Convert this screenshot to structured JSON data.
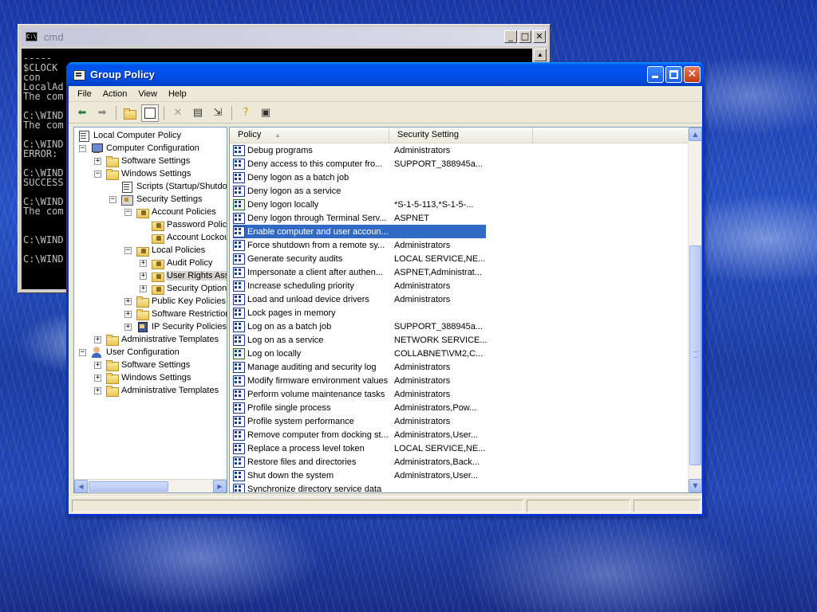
{
  "cmd": {
    "title": "cmd",
    "lines": [
      "-----",
      "$CLOCK",
      "con",
      "LocalAd",
      "The com",
      "",
      "C:\\WIND",
      "The com",
      "",
      "C:\\WIND",
      "ERROR:",
      "",
      "C:\\WIND",
      "SUCCESS",
      "",
      "C:\\WIND",
      "The com",
      "",
      "",
      "C:\\WIND",
      "",
      "C:\\WIND"
    ]
  },
  "window": {
    "title": "Group Policy"
  },
  "menu": {
    "file": "File",
    "action": "Action",
    "view": "View",
    "help": "Help"
  },
  "tree": {
    "root": "Local Computer Policy",
    "computer_config": "Computer Configuration",
    "cc_software": "Software Settings",
    "cc_windows": "Windows Settings",
    "scripts": "Scripts (Startup/Shutdown)",
    "security": "Security Settings",
    "account_policies": "Account Policies",
    "password_policy": "Password Policy",
    "account_lockout": "Account Lockout Policy",
    "local_policies": "Local Policies",
    "audit_policy": "Audit Policy",
    "user_rights": "User Rights Assignment",
    "security_options": "Security Options",
    "public_key": "Public Key Policies",
    "software_restriction": "Software Restriction Policies",
    "ip_security": "IP Security Policies",
    "cc_admin_templates": "Administrative Templates",
    "user_config": "User Configuration",
    "uc_software": "Software Settings",
    "uc_windows": "Windows Settings",
    "uc_admin_templates": "Administrative Templates"
  },
  "list": {
    "col_policy": "Policy",
    "col_setting": "Security Setting",
    "rows": [
      {
        "policy": "Debug programs",
        "setting": "Administrators"
      },
      {
        "policy": "Deny access to this computer fro...",
        "setting": "SUPPORT_388945a..."
      },
      {
        "policy": "Deny logon as a batch job",
        "setting": ""
      },
      {
        "policy": "Deny logon as a service",
        "setting": ""
      },
      {
        "policy": "Deny logon locally",
        "setting": "*S-1-5-113,*S-1-5-..."
      },
      {
        "policy": "Deny logon through Terminal Serv...",
        "setting": "ASPNET"
      },
      {
        "policy": "Enable computer and user accoun...",
        "setting": ""
      },
      {
        "policy": "Force shutdown from a remote sy...",
        "setting": "Administrators"
      },
      {
        "policy": "Generate security audits",
        "setting": "LOCAL SERVICE,NE..."
      },
      {
        "policy": "Impersonate a client after authen...",
        "setting": "ASPNET,Administrat..."
      },
      {
        "policy": "Increase scheduling priority",
        "setting": "Administrators"
      },
      {
        "policy": "Load and unload device drivers",
        "setting": "Administrators"
      },
      {
        "policy": "Lock pages in memory",
        "setting": ""
      },
      {
        "policy": "Log on as a batch job",
        "setting": "SUPPORT_388945a..."
      },
      {
        "policy": "Log on as a service",
        "setting": "NETWORK SERVICE..."
      },
      {
        "policy": "Log on locally",
        "setting": "COLLABNET\\VM2,C..."
      },
      {
        "policy": "Manage auditing and security log",
        "setting": "Administrators"
      },
      {
        "policy": "Modify firmware environment values",
        "setting": "Administrators"
      },
      {
        "policy": "Perform volume maintenance tasks",
        "setting": "Administrators"
      },
      {
        "policy": "Profile single process",
        "setting": "Administrators,Pow..."
      },
      {
        "policy": "Profile system performance",
        "setting": "Administrators"
      },
      {
        "policy": "Remove computer from docking st...",
        "setting": "Administrators,User..."
      },
      {
        "policy": "Replace a process level token",
        "setting": "LOCAL SERVICE,NE..."
      },
      {
        "policy": "Restore files and directories",
        "setting": "Administrators,Back..."
      },
      {
        "policy": "Shut down the system",
        "setting": "Administrators,User..."
      },
      {
        "policy": "Synchronize directory service data",
        "setting": ""
      }
    ],
    "selected_index": 6
  },
  "colors": {
    "titlebar": "#0053ee",
    "selection": "#316ac5",
    "window_bg": "#ece9d8"
  },
  "icons": {
    "back": "back-arrow-icon",
    "forward": "forward-arrow-icon",
    "up": "up-folder-icon",
    "show_hide_tree": "show-hide-tree-icon",
    "delete": "delete-icon",
    "properties": "properties-icon",
    "export": "export-list-icon",
    "help": "help-icon",
    "console": "console-icon"
  }
}
